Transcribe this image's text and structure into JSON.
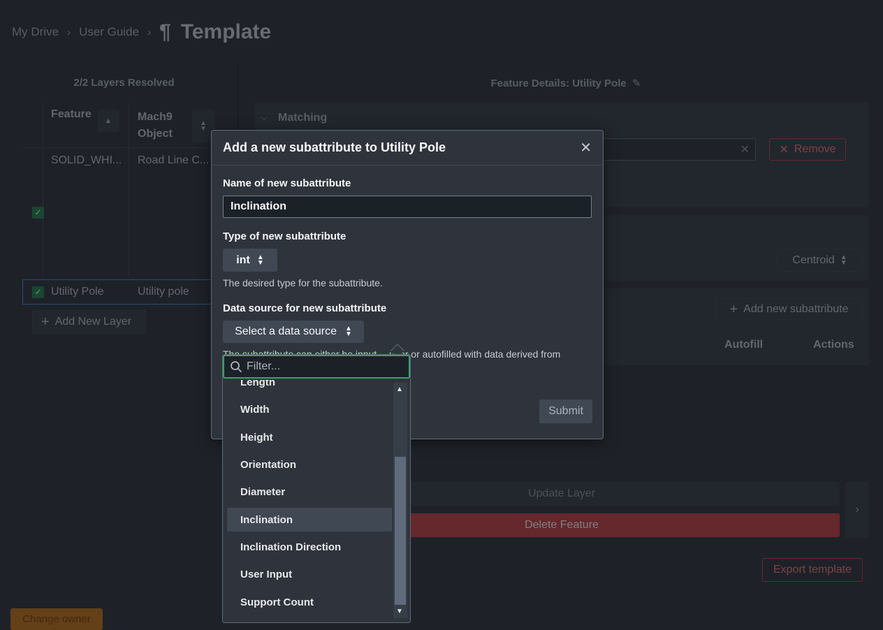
{
  "breadcrumb": {
    "items": [
      "My Drive",
      "User Guide"
    ],
    "separator": ">",
    "title_icon": "¶",
    "page_title": "Template"
  },
  "left_panel": {
    "layers_resolved": "2/2 Layers Resolved",
    "columns": [
      "Feature",
      "Mach9\nObject"
    ],
    "column_line1": "Mach9",
    "column_line2": "Object",
    "rows": [
      {
        "feature": "SOLID_WHI...",
        "object": "Road Line C...",
        "checked": true
      },
      {
        "feature": "Utility Pole",
        "object": "Utility pole",
        "checked": true
      }
    ],
    "add_layer_label": "Add New Layer"
  },
  "right_panel": {
    "feature_details": "Feature Details: Utility Pole",
    "matching_label": "Matching",
    "remove_label": "Remove",
    "centroid_label": "Centroid",
    "add_subattribute_label": "Add new subattribute",
    "table_headers": {
      "autofill": "Autofill",
      "actions": "Actions"
    },
    "update_layer_label": "Update Layer",
    "delete_feature_label": "Delete Feature",
    "export_label": "Export template"
  },
  "footer": {
    "change_owner_label": "Change owner"
  },
  "dialog": {
    "title": "Add a new subattribute to Utility Pole",
    "name_label": "Name of new subattribute",
    "name_value": "Inclination",
    "type_label": "Type of new subattribute",
    "type_value": "int",
    "type_helper": "The desired type for the subattribute.",
    "source_label": "Data source for new subattribute",
    "source_value": "Select a data source",
    "source_helper_left": "The subattribute can either be input ",
    "source_helper_right": "user or autofilled with data derived from",
    "submit_label": "Submit"
  },
  "dropdown": {
    "filter_placeholder": "Filter...",
    "options": [
      "Length",
      "Width",
      "Height",
      "Orientation",
      "Diameter",
      "Inclination",
      "Inclination Direction",
      "User Input",
      "Support Count"
    ],
    "active_option": "Inclination"
  },
  "colors": {
    "background": "#2f343c",
    "success": "#238551",
    "danger": "#cd4246",
    "warning": "#c87619",
    "focus": "#32a467"
  }
}
